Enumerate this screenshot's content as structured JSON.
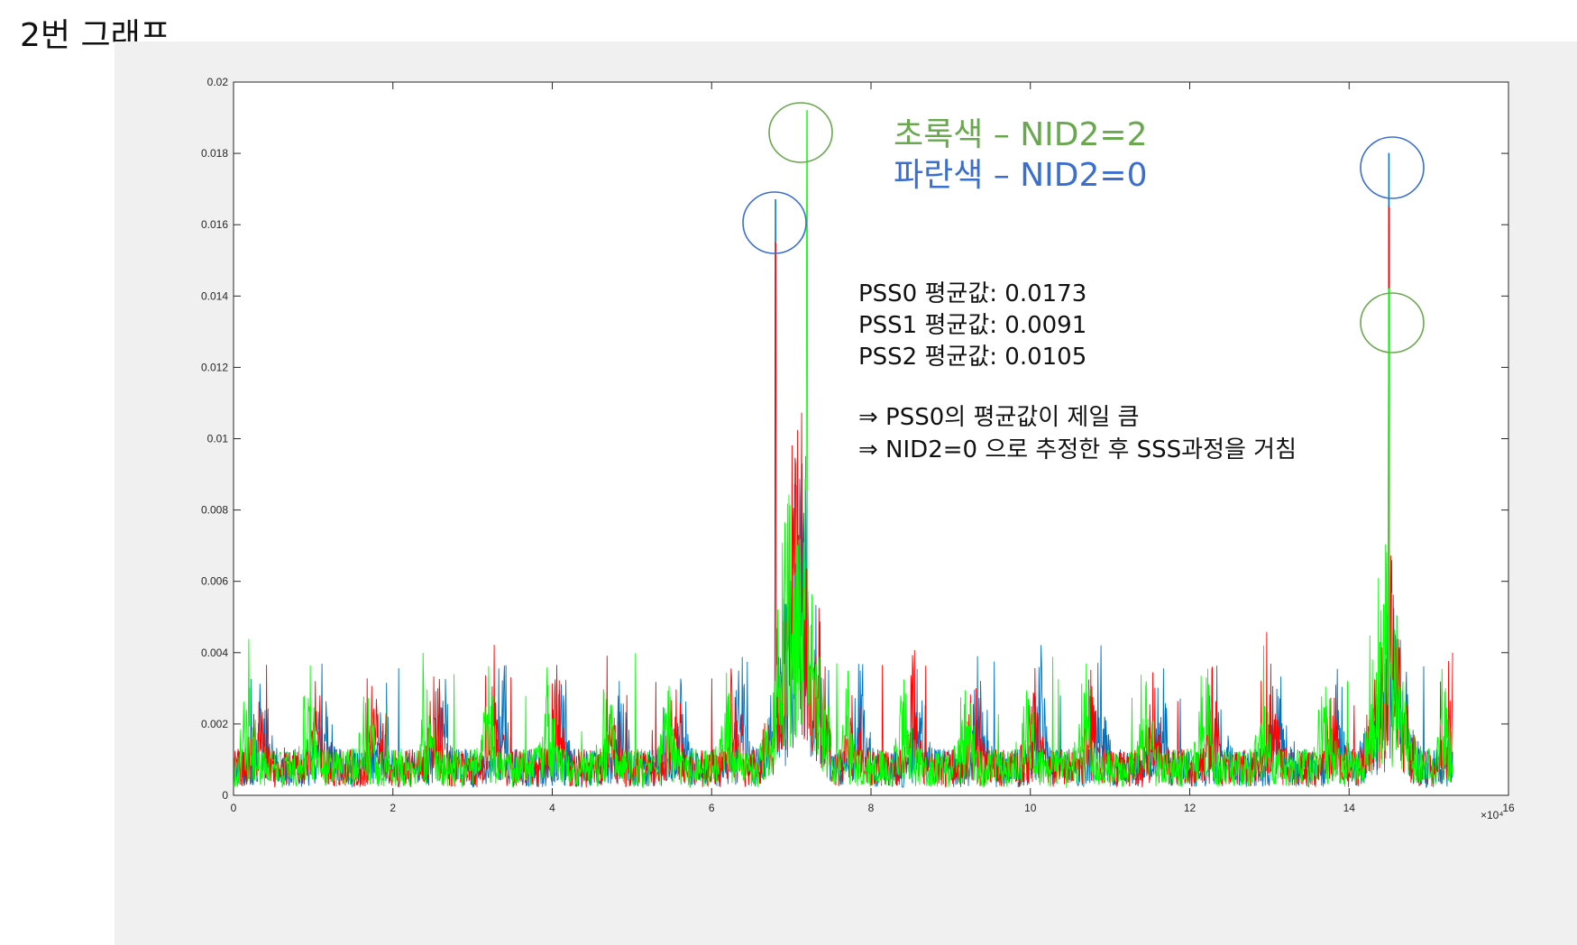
{
  "header": {
    "title": "2번 그래프"
  },
  "chart_data": {
    "type": "line",
    "x_exponent_label": "×10⁴",
    "xlim": [
      0,
      160000
    ],
    "ylim": [
      0,
      0.02
    ],
    "xticks": [
      0,
      20000,
      40000,
      60000,
      80000,
      100000,
      120000,
      140000,
      160000
    ],
    "xtick_labels": [
      "0",
      "2",
      "4",
      "6",
      "8",
      "10",
      "12",
      "14",
      "16"
    ],
    "yticks": [
      0,
      0.002,
      0.004,
      0.006,
      0.008,
      0.01,
      0.012,
      0.014,
      0.016,
      0.018,
      0.02
    ],
    "ytick_labels": [
      "0",
      "0.002",
      "0.004",
      "0.006",
      "0.008",
      "0.01",
      "0.012",
      "0.014",
      "0.016",
      "0.018",
      "0.02"
    ],
    "series": [
      {
        "color": "#0072bd",
        "peaks": [
          [
            68000,
            0.0167
          ],
          [
            145000,
            0.018
          ]
        ]
      },
      {
        "color": "#ff0000",
        "peaks": [
          [
            68000,
            0.0155
          ],
          [
            145000,
            0.0165
          ]
        ]
      },
      {
        "color": "#00ff00",
        "peaks": [
          [
            72000,
            0.0192
          ],
          [
            145000,
            0.0142
          ]
        ]
      }
    ],
    "annotations": {
      "legend_green": "초록색 – NID2=2",
      "legend_blue": "파란색 – NID2=0",
      "lines": [
        "PSS0 평균값: 0.0173",
        "PSS1 평균값: 0.0091",
        "PSS2 평균값: 0.0105",
        "⇒  PSS0의 평균값이 제일 큼",
        "⇒  NID2=0 으로 추정한 후 SSS과정을 거침"
      ]
    },
    "grid": false,
    "legend_placement": "top-right"
  },
  "colors": {
    "green_annotation": "#6aa84f",
    "blue_annotation": "#3a6fd0"
  }
}
